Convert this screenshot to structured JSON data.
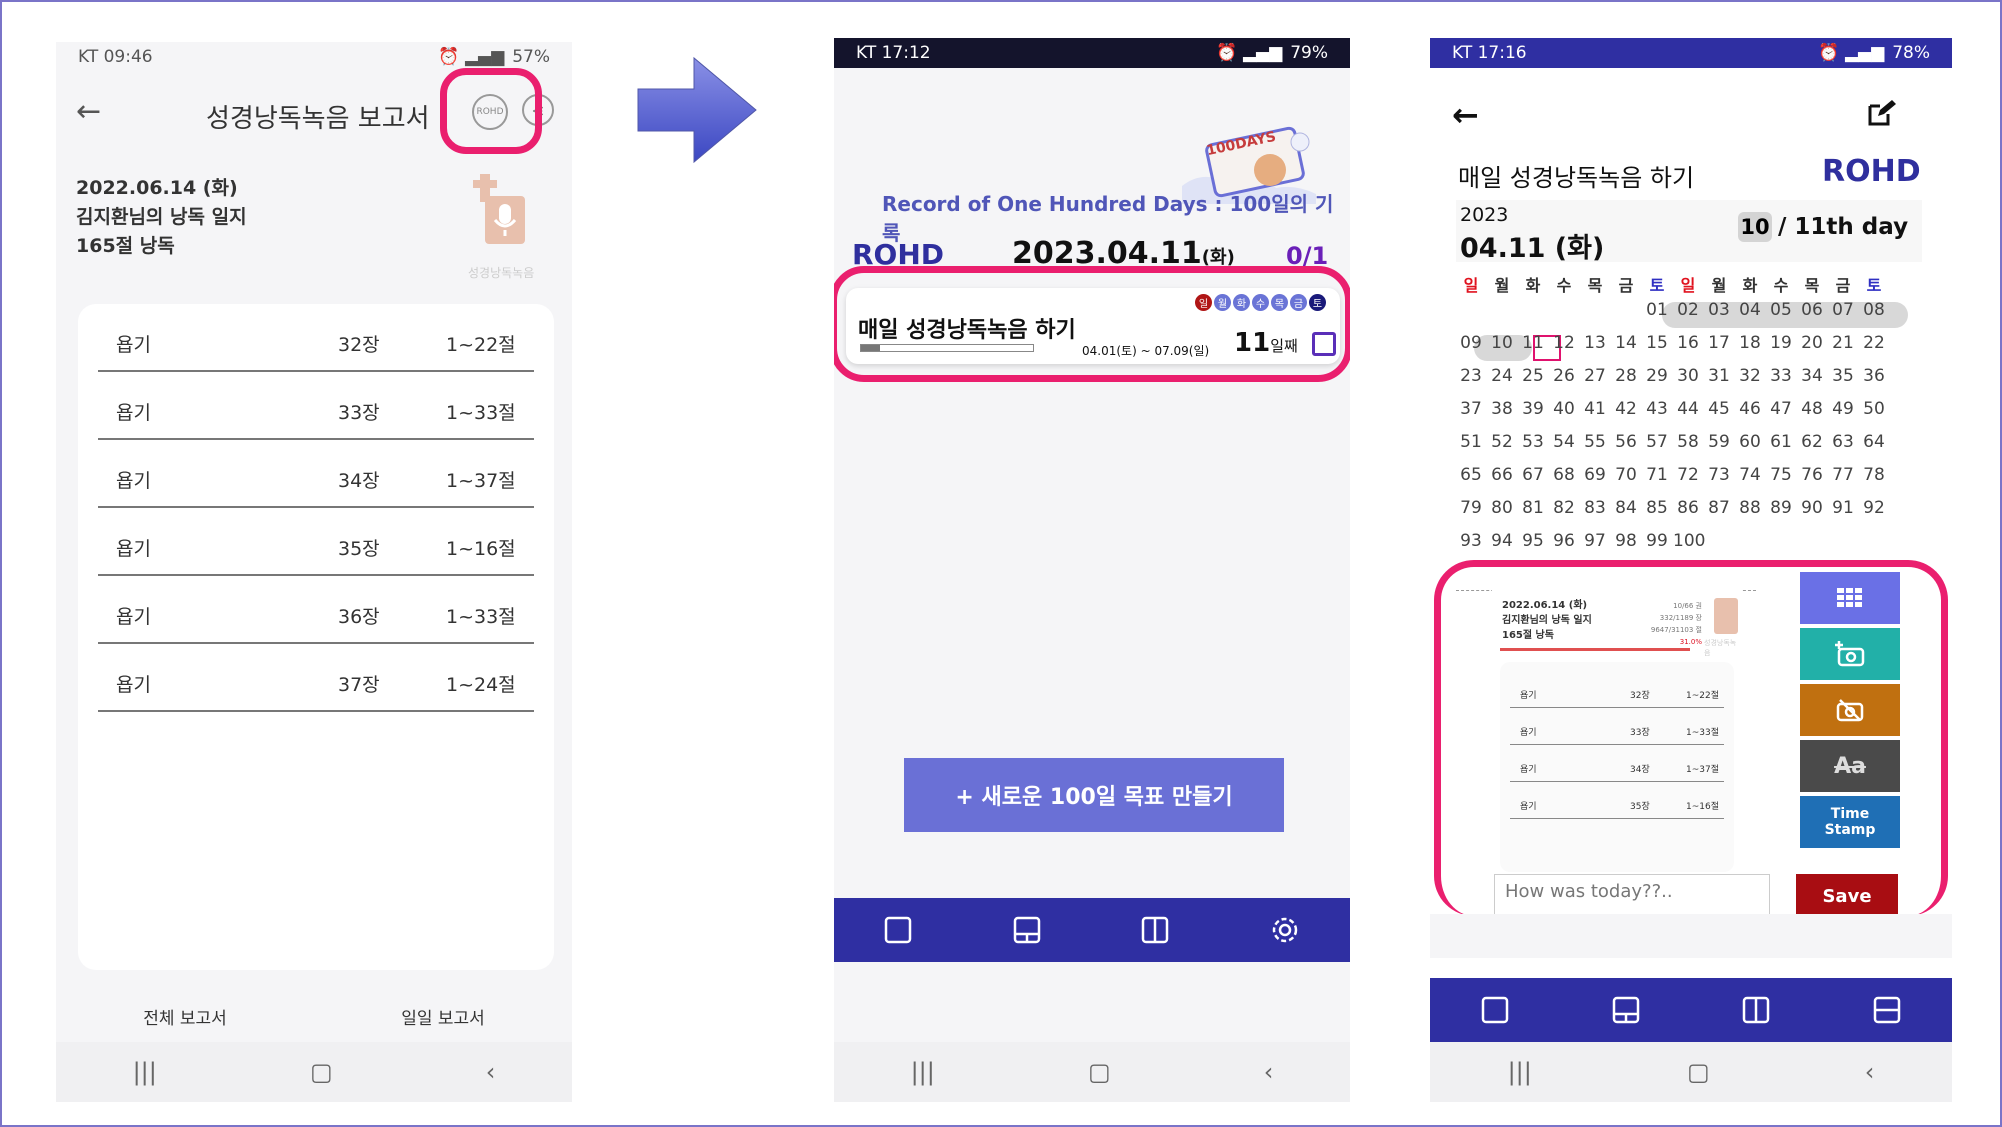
{
  "left_phone": {
    "status": {
      "carrier_time": "KT 09:46",
      "battery": "57%"
    },
    "header": {
      "title": "성경낭독녹음 보고서",
      "badge": "ROHD"
    },
    "report": {
      "date": "2022.06.14 (화)",
      "owner": "김지환님의 낭독 일지",
      "summary": "165절 낭독",
      "logo_label": "성경낭독녹음"
    },
    "rows": [
      {
        "book": "욥기",
        "chapter": "32장",
        "verses": "1~22절"
      },
      {
        "book": "욥기",
        "chapter": "33장",
        "verses": "1~33절"
      },
      {
        "book": "욥기",
        "chapter": "34장",
        "verses": "1~37절"
      },
      {
        "book": "욥기",
        "chapter": "35장",
        "verses": "1~16절"
      },
      {
        "book": "욥기",
        "chapter": "36장",
        "verses": "1~33절"
      },
      {
        "book": "욥기",
        "chapter": "37장",
        "verses": "1~24절"
      }
    ],
    "tabs": {
      "all": "전체 보고서",
      "daily": "일일 보고서"
    }
  },
  "middle_phone": {
    "status": {
      "carrier_time": "KT 17:12",
      "battery": "79%"
    },
    "banner_badge": "100DAYS",
    "subtitle": "Record of One Hundred Days : 100일의 기록",
    "brand": "ROHD",
    "date_main": "2023.04.11",
    "date_day": "(화)",
    "count": "0/1",
    "goal": {
      "title": "매일 성경낭독녹음 하기",
      "range": "04.01(토) ~ 07.09(일)",
      "day_num": "11",
      "day_suffix": "일째",
      "weekdays": [
        "일",
        "월",
        "화",
        "수",
        "목",
        "금",
        "토"
      ],
      "progress": 0.11
    },
    "new_goal_button": "+ 새로운 100일 목표 만들기"
  },
  "right_phone": {
    "status": {
      "carrier_time": "KT 17:16",
      "battery": "78%"
    },
    "title": "매일 성경낭독녹음 하기",
    "brand": "ROHD",
    "year": "2023",
    "date": "04.11 (화)",
    "day_badge": "10",
    "day_label": "/ 11th day",
    "weekday_headers": [
      "일",
      "월",
      "화",
      "수",
      "목",
      "금",
      "토",
      "일",
      "월",
      "화",
      "수",
      "목",
      "금",
      "토"
    ],
    "mini_report": {
      "date": "2022.06.14 (화)",
      "owner": "김지환님의 낭독 일지",
      "summary": "165절 낭독",
      "stat1": "10/66 권",
      "stat2": "332/1189 장",
      "stat3": "9647/31103 절",
      "percent": "31.0%",
      "logo_label": "성경낭독녹음",
      "rows": [
        {
          "book": "욥기",
          "chapter": "32장",
          "verses": "1~22절"
        },
        {
          "book": "욥기",
          "chapter": "33장",
          "verses": "1~33절"
        },
        {
          "book": "욥기",
          "chapter": "34장",
          "verses": "1~37절"
        },
        {
          "book": "욥기",
          "chapter": "35장",
          "verses": "1~16절"
        }
      ]
    },
    "font_button": "Aa",
    "timestamp_button": "Time Stamp",
    "memo_placeholder": "How was today??..",
    "save_button": "Save"
  },
  "colors": {
    "highlight": "#ea1f6e",
    "navbar": "#2f2fa2",
    "brand": "#2f2f9e",
    "accent_red": "#e0121e"
  }
}
